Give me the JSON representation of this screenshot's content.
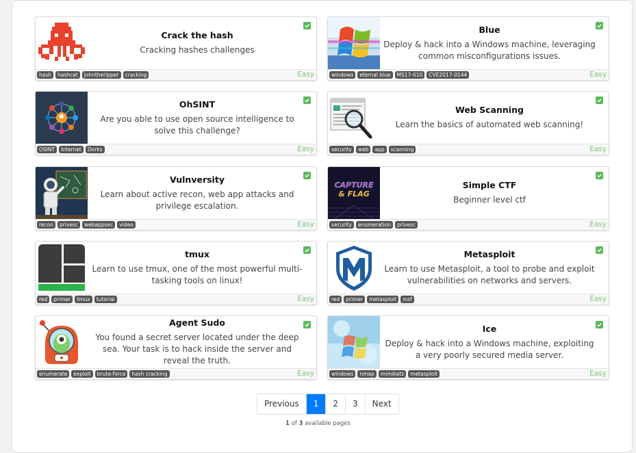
{
  "cards": [
    {
      "title": "Crack the hash",
      "desc": "Cracking hashes challenges",
      "tags": [
        "hash",
        "hashcat",
        "johntheripper",
        "cracking"
      ],
      "difficulty": "Easy",
      "thumb": "octopus-icon"
    },
    {
      "title": "Blue",
      "desc": "Deploy & hack into a Windows machine, leveraging common misconfigurations issues.",
      "tags": [
        "windows",
        "eternal blue",
        "MS17-010",
        "CVE2017-0144"
      ],
      "difficulty": "Easy",
      "thumb": "windows-logo-icon"
    },
    {
      "title": "OhSINT",
      "desc": "Are you able to use open source intelligence to solve this challenge?",
      "tags": [
        "OSINT",
        "Internet",
        "Dorks"
      ],
      "difficulty": "Easy",
      "thumb": "network-icon"
    },
    {
      "title": "Web Scanning",
      "desc": "Learn the basics of automated web scanning!",
      "tags": [
        "security",
        "web",
        "app",
        "scanning"
      ],
      "difficulty": "Easy",
      "thumb": "magnifier-icon"
    },
    {
      "title": "Vulnversity",
      "desc": "Learn about active recon, web app attacks and privilege escalation.",
      "tags": [
        "recon",
        "privesc",
        "webappsec",
        "video"
      ],
      "difficulty": "Easy",
      "thumb": "astronaut-icon"
    },
    {
      "title": "Simple CTF",
      "desc": "Beginner level ctf",
      "tags": [
        "security",
        "enumeration",
        "privesc"
      ],
      "difficulty": "Easy",
      "thumb": "capture-flag-icon"
    },
    {
      "title": "tmux",
      "desc": "Learn to use tmux, one of the most powerful multi-tasking tools on linux!",
      "tags": [
        "red",
        "primer",
        "tmux",
        "tutorial"
      ],
      "difficulty": "Easy",
      "thumb": "tmux-icon"
    },
    {
      "title": "Metasploit",
      "desc": "Learn to use Metasploit, a tool to probe and exploit vulnerabilities on networks and servers.",
      "tags": [
        "red",
        "primer",
        "metasploit",
        "msf"
      ],
      "difficulty": "Easy",
      "thumb": "metasploit-icon"
    },
    {
      "title": "Agent Sudo",
      "desc": "You found a secret server located under the deep sea. Your task is to hack inside the server and reveal the truth.",
      "tags": [
        "enumerate",
        "exploit",
        "brute-force",
        "hash cracking"
      ],
      "difficulty": "Easy",
      "thumb": "robot-diver-icon"
    },
    {
      "title": "Ice",
      "desc": "Deploy & hack into a Windows machine, exploiting a very poorly secured media server.",
      "tags": [
        "windows",
        "nmap",
        "mimikatz",
        "metasploit"
      ],
      "difficulty": "Easy",
      "thumb": "windows-ice-icon"
    }
  ],
  "pagination": {
    "previous": "Previous",
    "pages": [
      "1",
      "2",
      "3"
    ],
    "next": "Next",
    "current": "1",
    "total": "3",
    "info_mid": " of ",
    "info_end": " available pages"
  },
  "colors": {
    "accent": "#007bff",
    "completed": "#5cb85c",
    "easy": "#7cc47c",
    "tag_bg": "#555555"
  }
}
